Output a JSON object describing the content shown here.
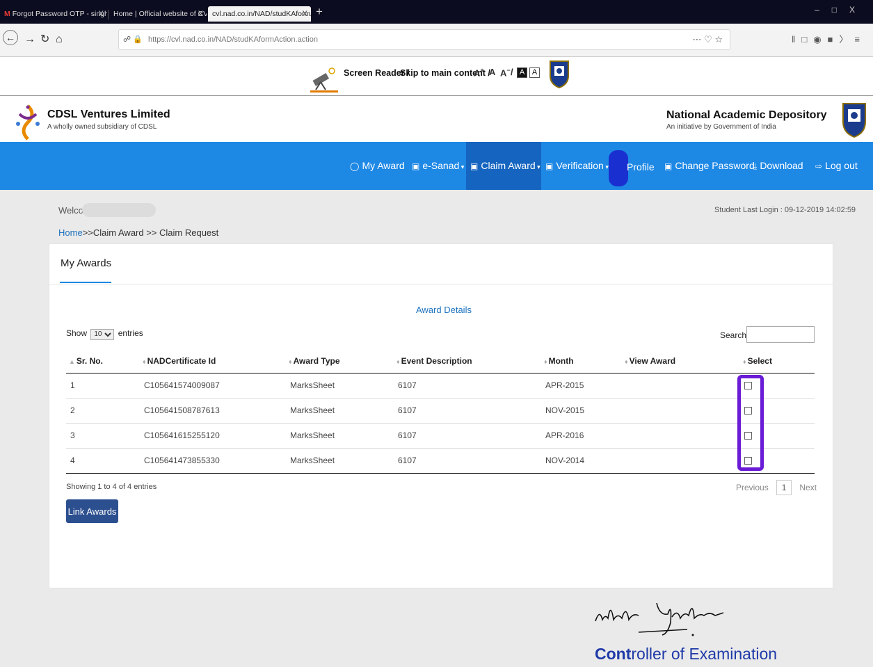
{
  "browser": {
    "tabs": [
      {
        "title": "Forgot Password OTP - singhar",
        "close": "X"
      },
      {
        "title": "Home | Official website of CVL-Nat",
        "close": "X"
      },
      {
        "title": "cvl.nad.co.in/NAD/studKAformAct",
        "close": "X"
      }
    ],
    "new_tab": "+",
    "url": "https://cvl.nad.co.in/NAD/studKAformAction.action"
  },
  "accessibility": {
    "screen_reader": "Screen Reader /",
    "skip": "Skip to main content /",
    "a_plus": "A",
    "a_norm": "A",
    "a_minus": "A",
    "slash": "/",
    "contrast_dark": "A",
    "contrast_light": "A"
  },
  "header": {
    "org_name": "CDSL Ventures Limited",
    "org_sub": "A wholly owned subsidiary of CDSL",
    "nad_name": "National Academic Depository",
    "nad_sub": "An initiative by Government of India"
  },
  "menu": {
    "my_award": "My Award",
    "e_sanad": "e-Sanad",
    "claim_award": "Claim Award",
    "verification": "Verification",
    "profile": "Profile",
    "change_password": "Change Password",
    "download": "Download",
    "logout": "Log out"
  },
  "page": {
    "welcome": "Welcome",
    "last_login": "Student Last Login : 09-12-2019 14:02:59",
    "breadcrumb_home": "Home",
    "breadcrumb_rest": ">>Claim Award >> Claim Request",
    "panel_title": "My Awards",
    "section_title": "Award Details",
    "show_label": "Show",
    "entries_label": "entries",
    "entries_value": "10",
    "search_label": "Search:",
    "columns": [
      "Sr. No.",
      "NADCertificate Id",
      "Award Type",
      "Event Description",
      "Month",
      "View Award",
      "Select"
    ],
    "rows": [
      {
        "sr": "1",
        "id": "C105641574009087",
        "type": "MarksSheet",
        "event": "6107",
        "month": "APR-2015",
        "view": ""
      },
      {
        "sr": "2",
        "id": "C105641508787613",
        "type": "MarksSheet",
        "event": "6107",
        "month": "NOV-2015",
        "view": ""
      },
      {
        "sr": "3",
        "id": "C105641615255120",
        "type": "MarksSheet",
        "event": "6107",
        "month": "APR-2016",
        "view": ""
      },
      {
        "sr": "4",
        "id": "C105641473855330",
        "type": "MarksSheet",
        "event": "6107",
        "month": "NOV-2014",
        "view": ""
      }
    ],
    "showing": "Showing 1 to 4 of 4 entries",
    "prev": "Previous",
    "page_num": "1",
    "next": "Next",
    "link_button": "Link Awards"
  },
  "stamp": {
    "controller_prefix": "Cont",
    "controller_rest": "roller of Examination"
  },
  "colors": {
    "menu_blue": "#1e88e5",
    "menu_active": "#1565c0",
    "link_button": "#2c4f8f",
    "highlight_marker": "#6a1bd6"
  }
}
